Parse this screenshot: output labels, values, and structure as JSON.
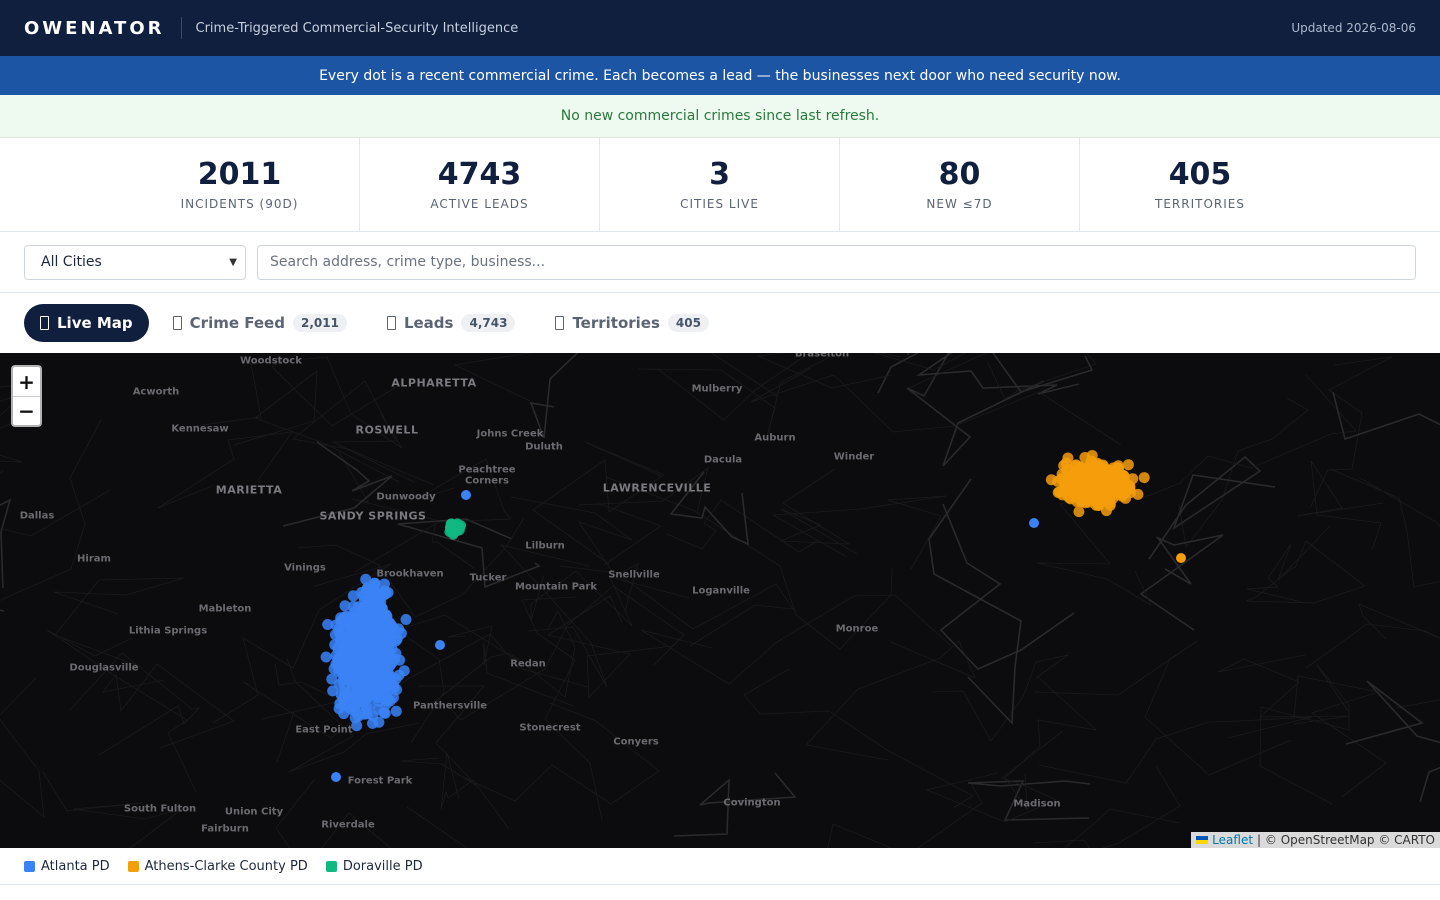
{
  "header": {
    "brand": "OWENATOR",
    "tagline": "Crime-Triggered Commercial-Security Intelligence",
    "updated": "Updated 2026-08-06"
  },
  "banner": "Every dot is a recent commercial crime. Each becomes a lead — the businesses next door who need security now.",
  "notice": "No new commercial crimes since last refresh.",
  "stats": [
    {
      "value": "2011",
      "label": "INCIDENTS (90D)"
    },
    {
      "value": "4743",
      "label": "ACTIVE LEADS"
    },
    {
      "value": "3",
      "label": "CITIES LIVE"
    },
    {
      "value": "80",
      "label": "NEW ≤7D"
    },
    {
      "value": "405",
      "label": "TERRITORIES"
    }
  ],
  "filters": {
    "city_selected": "All Cities",
    "search_placeholder": "Search address, crime type, business..."
  },
  "tabs": [
    {
      "label": "Live Map",
      "count": "",
      "active": true
    },
    {
      "label": "Crime Feed",
      "count": "2,011",
      "active": false
    },
    {
      "label": "Leads",
      "count": "4,743",
      "active": false
    },
    {
      "label": "Territories",
      "count": "405",
      "active": false
    }
  ],
  "map": {
    "zoom_in": "+",
    "zoom_out": "−",
    "attribution_link": "Leaflet",
    "attribution_text": "| © OpenStreetMap © CARTO",
    "places": [
      {
        "name": "Woodstock",
        "major": false
      },
      {
        "name": "Acworth",
        "major": false
      },
      {
        "name": "ALPHARETTA",
        "major": true
      },
      {
        "name": "Braselton",
        "major": false
      },
      {
        "name": "Mulberry",
        "major": false
      },
      {
        "name": "Kennesaw",
        "major": false
      },
      {
        "name": "ROSWELL",
        "major": true
      },
      {
        "name": "Johns Creek",
        "major": false
      },
      {
        "name": "Duluth",
        "major": false
      },
      {
        "name": "Auburn",
        "major": false
      },
      {
        "name": "Dacula",
        "major": false
      },
      {
        "name": "Winder",
        "major": false
      },
      {
        "name": "Peachtree",
        "major": false
      },
      {
        "name": "Corners",
        "major": false
      },
      {
        "name": "MARIETTA",
        "major": true
      },
      {
        "name": "LAWRENCEVILLE",
        "major": true
      },
      {
        "name": "Dunwoody",
        "major": false
      },
      {
        "name": "SANDY SPRINGS",
        "major": true
      },
      {
        "name": "Dallas",
        "major": false
      },
      {
        "name": "Lilburn",
        "major": false
      },
      {
        "name": "Hiram",
        "major": false
      },
      {
        "name": "Vinings",
        "major": false
      },
      {
        "name": "Brookhaven",
        "major": false
      },
      {
        "name": "Snellville",
        "major": false
      },
      {
        "name": "Tucker",
        "major": false
      },
      {
        "name": "Mountain Park",
        "major": false
      },
      {
        "name": "Loganville",
        "major": false
      },
      {
        "name": "Mableton",
        "major": false
      },
      {
        "name": "Lithia Springs",
        "major": false
      },
      {
        "name": "Monroe",
        "major": false
      },
      {
        "name": "Douglasville",
        "major": false
      },
      {
        "name": "Redan",
        "major": false
      },
      {
        "name": "Panthersville",
        "major": false
      },
      {
        "name": "East Point",
        "major": false
      },
      {
        "name": "Stonecrest",
        "major": false
      },
      {
        "name": "Conyers",
        "major": false
      },
      {
        "name": "Forest Park",
        "major": false
      },
      {
        "name": "Covington",
        "major": false
      },
      {
        "name": "South Fulton",
        "major": false
      },
      {
        "name": "Union City",
        "major": false
      },
      {
        "name": "Madison",
        "major": false
      },
      {
        "name": "Fairburn",
        "major": false
      },
      {
        "name": "Riverdale",
        "major": false
      }
    ]
  },
  "legend": [
    {
      "label": "Atlanta PD",
      "color": "#3b82f6"
    },
    {
      "label": "Athens-Clarke County PD",
      "color": "#f59e0b"
    },
    {
      "label": "Doraville PD",
      "color": "#10b981"
    }
  ]
}
